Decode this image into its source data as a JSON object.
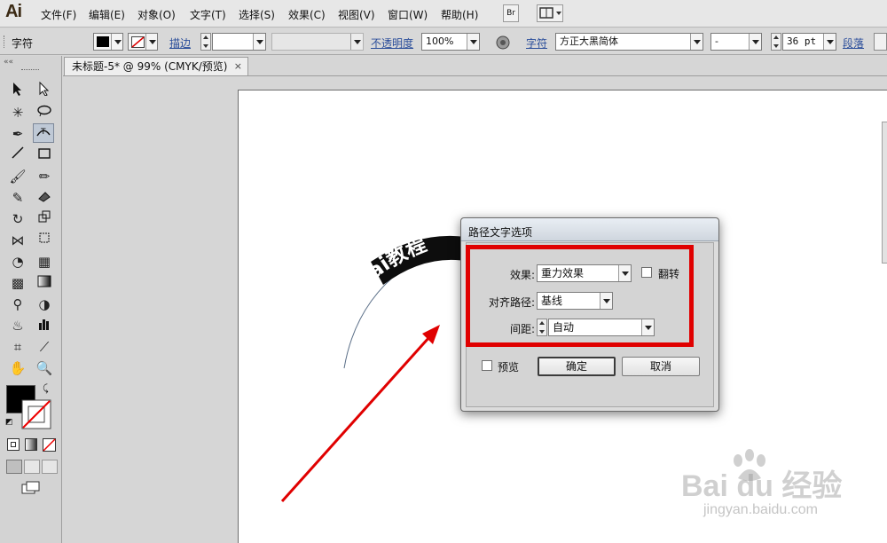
{
  "app": {
    "logo": "Ai",
    "menu": [
      "文件(F)",
      "编辑(E)",
      "对象(O)",
      "文字(T)",
      "选择(S)",
      "效果(C)",
      "视图(V)",
      "窗口(W)",
      "帮助(H)"
    ],
    "bridge_button": "Br",
    "arrange_icon": "arrange-documents-icon"
  },
  "control_bar": {
    "panel_label": "字符",
    "stroke_label": "描边",
    "opacity_label": "不透明度",
    "opacity_value": "100%",
    "char_label": "字符",
    "font_family": "方正大黑简体",
    "font_style": "-",
    "font_size": "36 pt",
    "paragraph_label": "段落",
    "fill_color": "#000000",
    "stroke_color": "none"
  },
  "document": {
    "tab_title": "未标题-5* @ 99% (CMYK/预览)",
    "close_glyph": "×"
  },
  "artwork": {
    "path_text": "ai教程"
  },
  "dialog": {
    "title": "路径文字选项",
    "effect_label": "效果:",
    "effect_value": "重力效果",
    "flip_label": "翻转",
    "align_label": "对齐路径:",
    "align_value": "基线",
    "spacing_label": "间距:",
    "spacing_value": "自动",
    "preview_label": "预览",
    "ok_label": "确定",
    "cancel_label": "取消",
    "flip_checked": false,
    "preview_checked": false
  },
  "annotation": {
    "highlight_color": "#e00000",
    "arrow_color": "#e00000"
  },
  "watermark": {
    "brand": "Bai  du 经验",
    "url": "jingyan.baidu.com"
  }
}
